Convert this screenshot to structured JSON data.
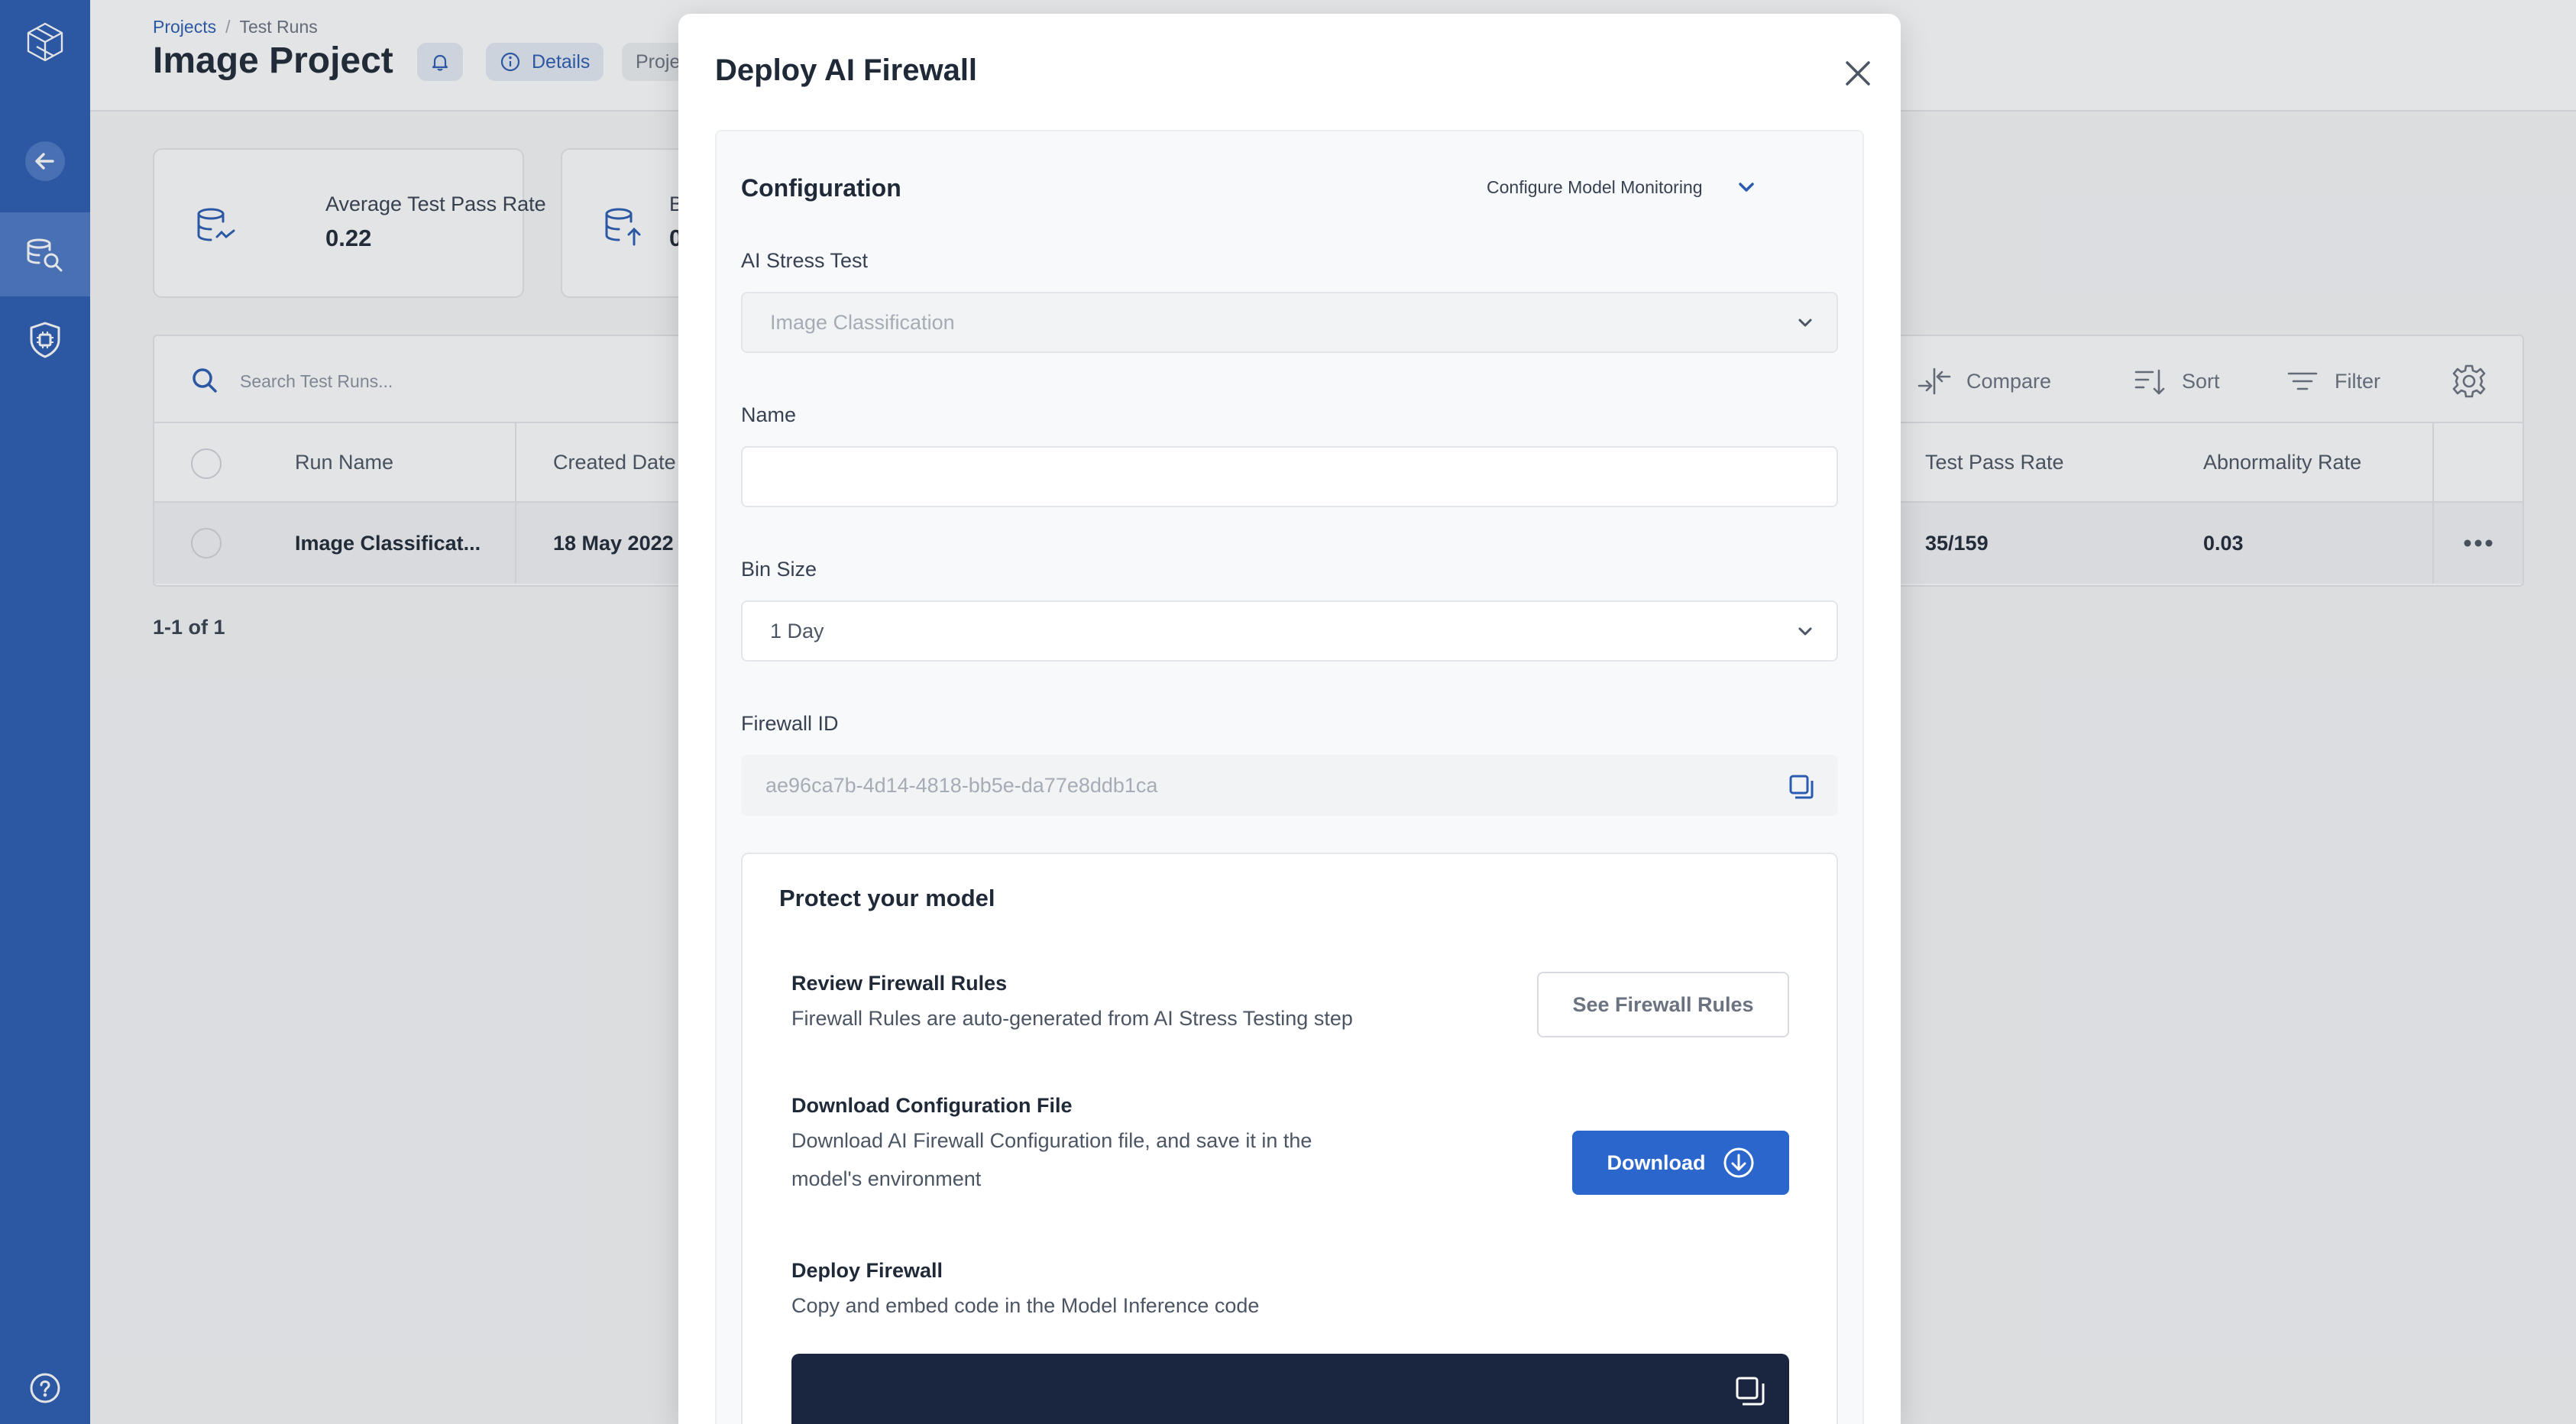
{
  "sidebar": {
    "items": [
      {
        "name": "logo",
        "icon": "cube-logo-icon"
      },
      {
        "name": "back",
        "icon": "arrow-left-icon"
      },
      {
        "name": "test-runs",
        "icon": "database-search-icon",
        "active": true
      },
      {
        "name": "firewall",
        "icon": "shield-chip-icon"
      },
      {
        "name": "help",
        "icon": "help-circle-icon"
      }
    ],
    "accent": "#2a5bb1"
  },
  "header": {
    "breadcrumb": {
      "root": "Projects",
      "current": "Test Runs"
    },
    "title": "Image Project",
    "details_label": "Details",
    "project_pill_label": "Proje"
  },
  "cards": [
    {
      "label": "Average Test Pass Rate",
      "value": "0.22"
    },
    {
      "label": "B",
      "value": "0"
    }
  ],
  "table": {
    "search_placeholder": "Search Test Runs...",
    "tools": {
      "compare": "Compare",
      "sort": "Sort",
      "filter": "Filter"
    },
    "columns": {
      "run_name": "Run Name",
      "created_date": "Created Date",
      "test_pass_rate": "Test Pass Rate",
      "abnormality_rate": "Abnormality Rate"
    },
    "rows": [
      {
        "run_name": "Image Classificat...",
        "created_date": "18 May 2022",
        "test_pass_rate": "35/159",
        "abnormality_rate": "0.03"
      }
    ],
    "pagination": "1-1 of 1"
  },
  "modal": {
    "title": "Deploy AI Firewall",
    "config_title": "Configuration",
    "config_select": "Configure Model Monitoring",
    "fields": {
      "stress_test_label": "AI Stress Test",
      "stress_test_value": "Image Classification",
      "name_label": "Name",
      "name_value": "",
      "bin_size_label": "Bin Size",
      "bin_size_value": "1 Day",
      "firewall_id_label": "Firewall ID",
      "firewall_id_value": "ae96ca7b-4d14-4818-bb5e-da77e8ddb1ca"
    },
    "protect": {
      "title": "Protect your model",
      "review_title": "Review Firewall Rules",
      "review_text": "Firewall Rules are auto-generated from AI Stress Testing step",
      "review_button": "See Firewall Rules",
      "download_title": "Download Configuration File",
      "download_text": "Download AI Firewall Configuration file, and save it in the model's environment",
      "download_button": "Download",
      "deploy_title": "Deploy Firewall",
      "deploy_text": "Copy and embed code in the Model Inference code"
    }
  },
  "colors": {
    "primary": "#2a66cc",
    "sidebar": "#2a5bb1",
    "code_bg": "#1a2540"
  }
}
